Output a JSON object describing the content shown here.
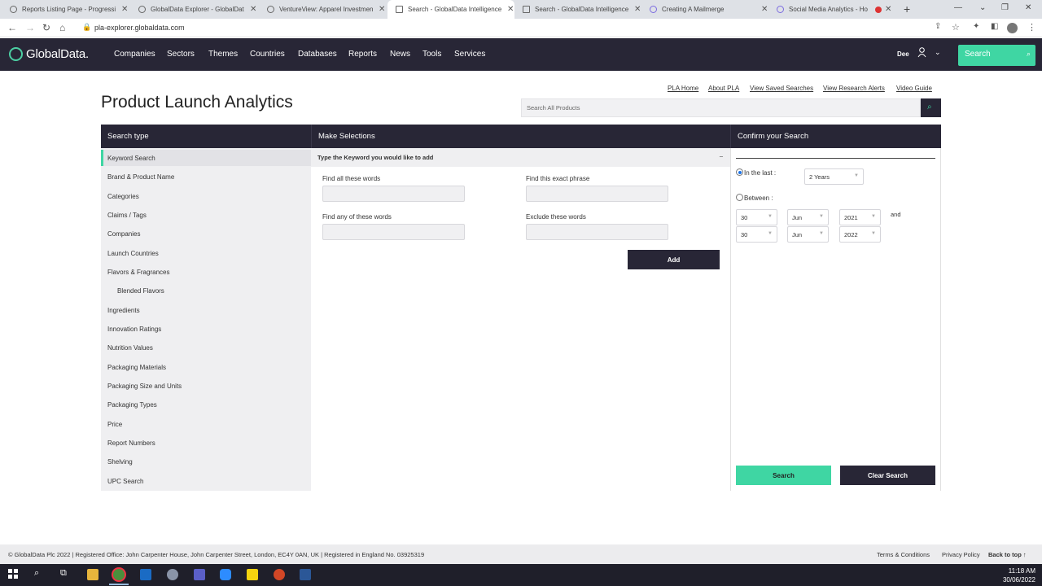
{
  "browser": {
    "tabs": [
      {
        "title": "Reports Listing Page - Progressi"
      },
      {
        "title": "GlobalData Explorer - GlobalDat"
      },
      {
        "title": "VentureView: Apparel Investmen"
      },
      {
        "title": "Search - GlobalData Intelligence"
      },
      {
        "title": "Search - GlobalData Intelligence"
      },
      {
        "title": "Creating A Mailmerge"
      },
      {
        "title": "Social Media Analytics - Ho"
      }
    ],
    "url": "pla-explorer.globaldata.com"
  },
  "header": {
    "logo": "GlobalData.",
    "nav": [
      "Companies",
      "Sectors",
      "Themes",
      "Countries",
      "Databases",
      "Reports",
      "News",
      "Tools",
      "Services"
    ],
    "user": "Dee",
    "search_label": "Search"
  },
  "toplinks": [
    "PLA Home",
    "About PLA",
    "View Saved Searches",
    "View Research Alerts",
    "Video Guide"
  ],
  "page": {
    "title": "Product Launch Analytics",
    "search_placeholder": "Search All Products"
  },
  "search_type": {
    "heading": "Search type",
    "items": [
      "Keyword Search",
      "Brand & Product Name",
      "Categories",
      "Claims / Tags",
      "Companies",
      "Launch Countries",
      "Flavors & Fragrances",
      "Blended Flavors",
      "Ingredients",
      "Innovation Ratings",
      "Nutrition Values",
      "Packaging Materials",
      "Packaging Size and Units",
      "Packaging Types",
      "Price",
      "Report Numbers",
      "Shelving",
      "UPC Search"
    ]
  },
  "selections": {
    "heading": "Make Selections",
    "keyword_bar": "Type the Keyword you would like to add",
    "collapse": "–",
    "find_all": "Find all these words",
    "find_phrase": "Find this exact phrase",
    "find_any": "Find any of these words",
    "exclude": "Exclude these words",
    "add_button": "Add"
  },
  "confirm": {
    "heading": "Confirm your Search",
    "in_last_label": "In the last :",
    "in_last_value": "2 Years",
    "between_label": "Between :",
    "from_day": "30",
    "from_month": "Jun",
    "from_year": "2021",
    "and_label": "and",
    "to_day": "30",
    "to_month": "Jun",
    "to_year": "2022",
    "search_button": "Search",
    "clear_button": "Clear Search"
  },
  "footer": {
    "copyright": "© GlobalData Plc 2022 | Registered Office: John Carpenter House, John Carpenter Street, London, EC4Y 0AN, UK | Registered in England No. 03925319",
    "terms": "Terms & Conditions",
    "privacy": "Privacy Policy",
    "back_to_top": "Back to top ↑"
  },
  "taskbar": {
    "time": "11:18 AM",
    "date": "30/06/2022"
  }
}
